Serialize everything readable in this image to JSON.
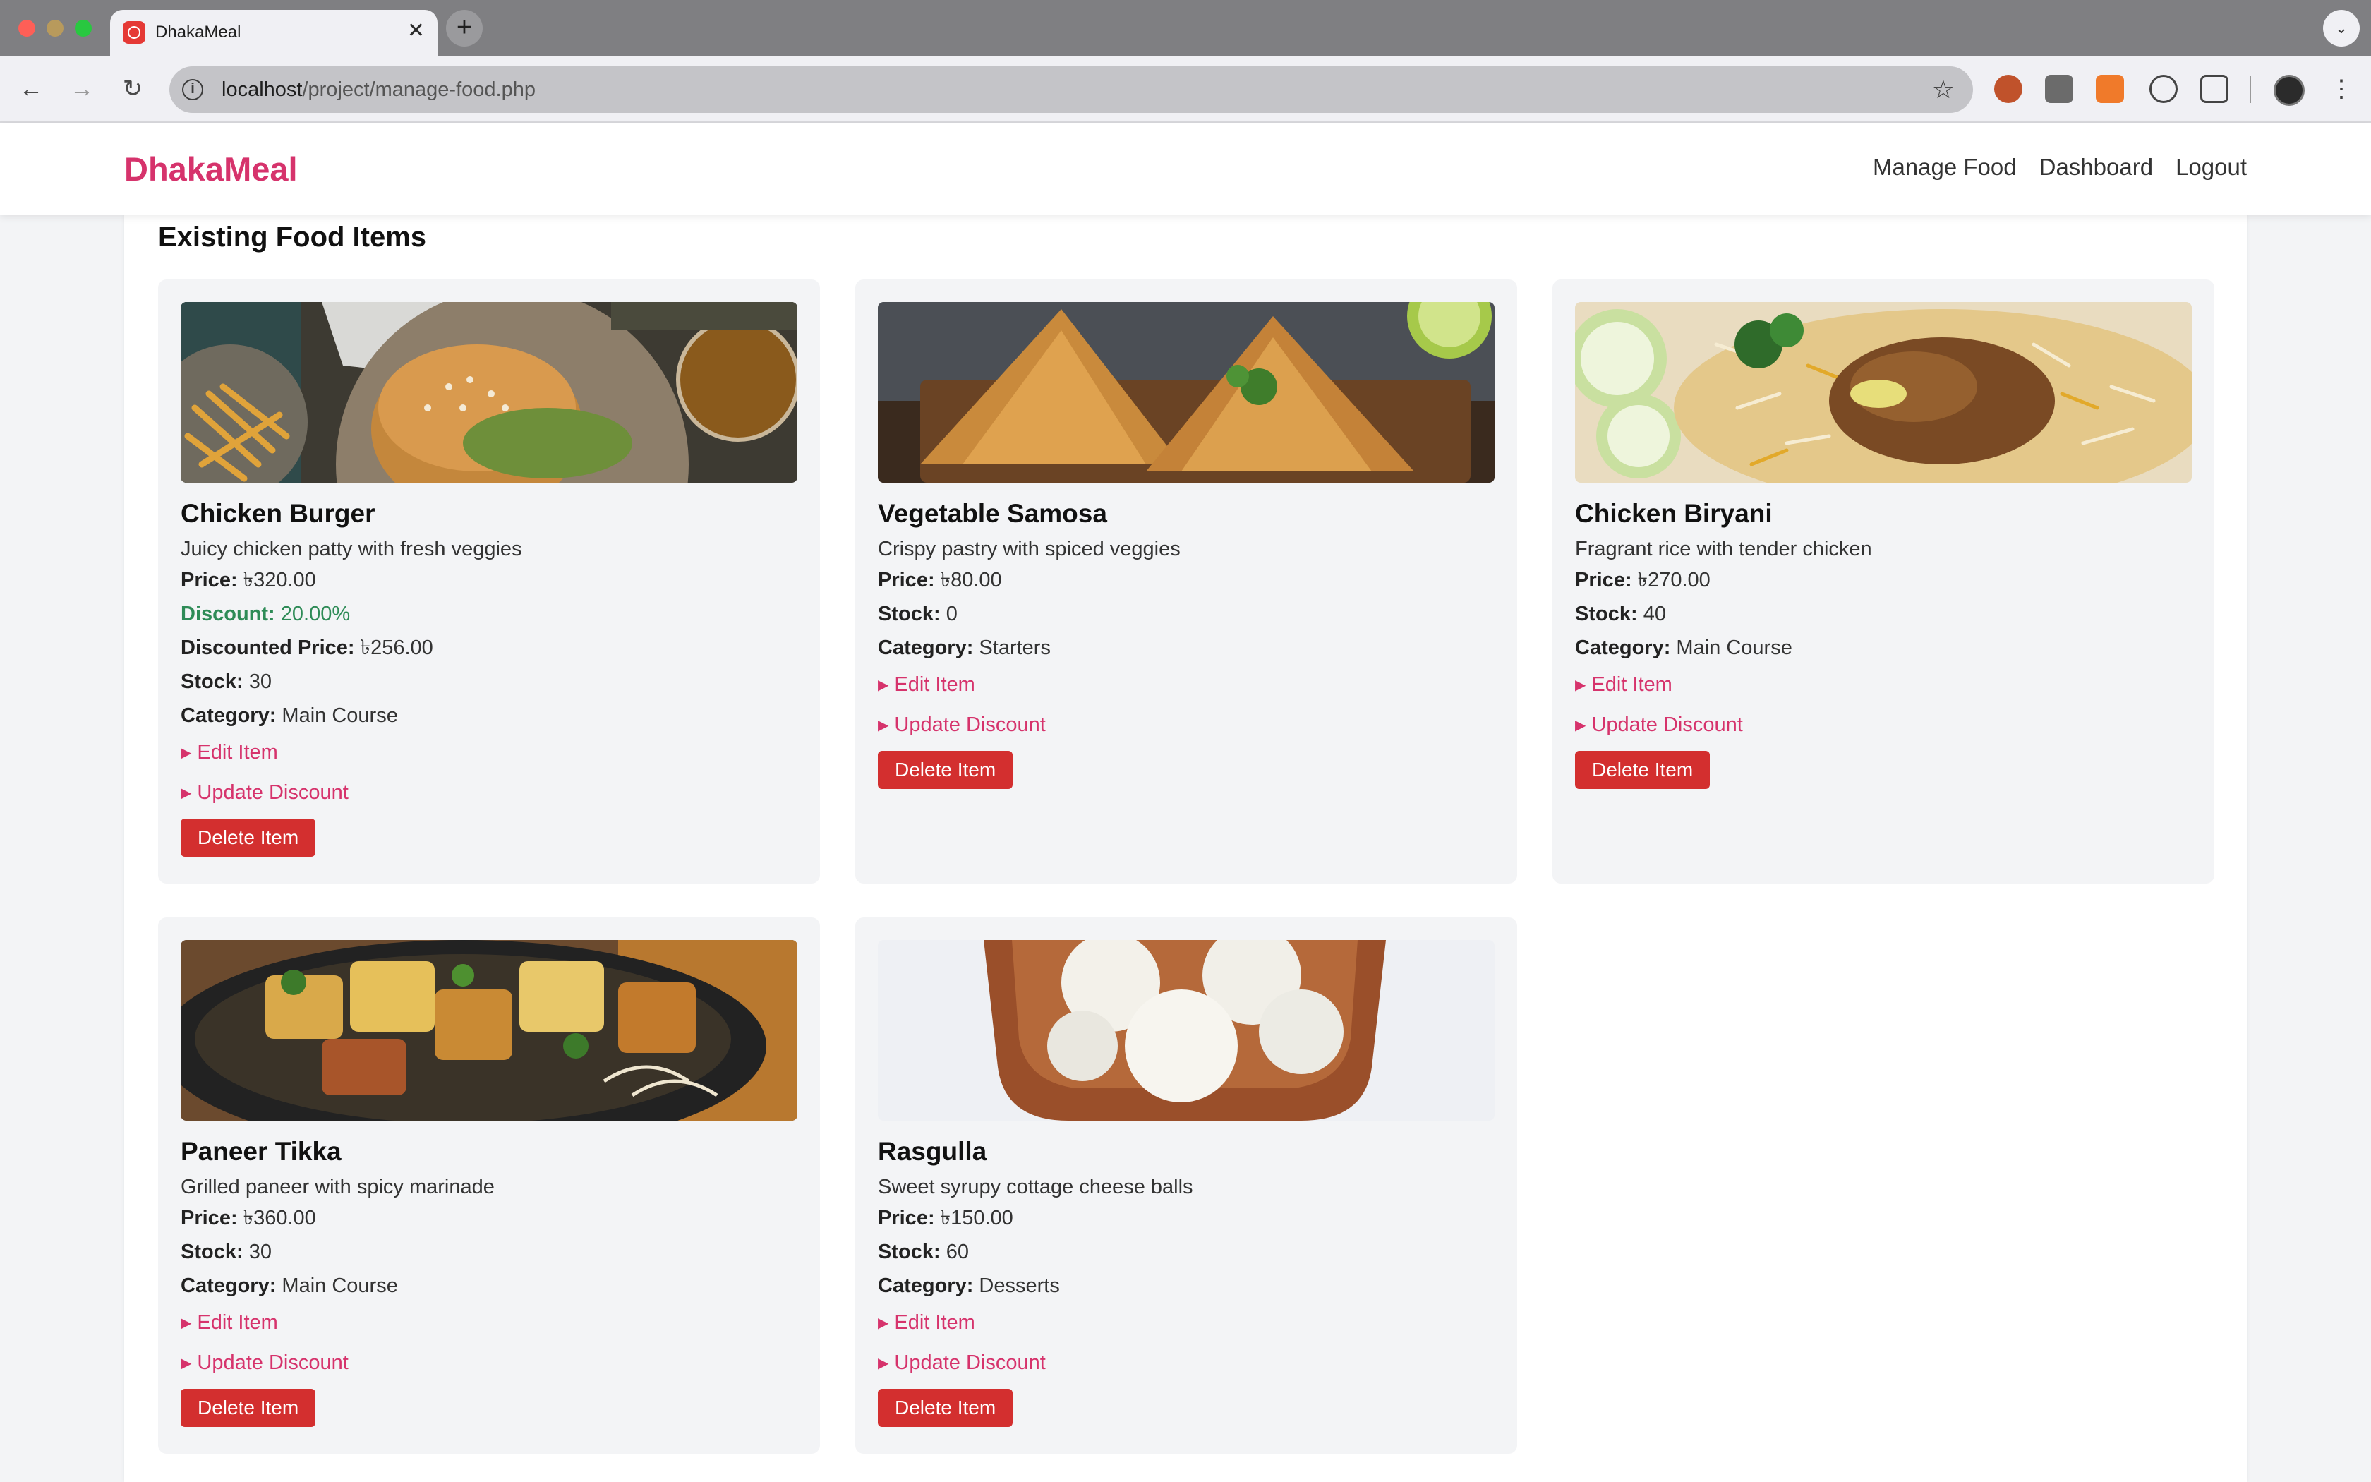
{
  "browser": {
    "tab_title": "DhakaMeal",
    "url_host": "localhost",
    "url_path": "/project/manage-food.php"
  },
  "site": {
    "brand": "DhakaMeal",
    "nav": [
      "Manage Food",
      "Dashboard",
      "Logout"
    ],
    "accent_color": "#d6336c",
    "danger_color": "#d32f2f",
    "discount_color": "#2e8b57"
  },
  "section_title": "Existing Food Items",
  "labels": {
    "price": "Price:",
    "discount": "Discount:",
    "discounted_price": "Discounted Price:",
    "stock": "Stock:",
    "category": "Category:",
    "edit": "Edit Item",
    "update_discount": "Update Discount",
    "delete": "Delete Item"
  },
  "items": [
    {
      "name": "Chicken Burger",
      "description": "Juicy chicken patty with fresh veggies",
      "price": "৳320.00",
      "discount": "20.00%",
      "discounted_price": "৳256.00",
      "stock": "30",
      "category": "Main Course",
      "image": "burger-photo"
    },
    {
      "name": "Vegetable Samosa",
      "description": "Crispy pastry with spiced veggies",
      "price": "৳80.00",
      "stock": "0",
      "category": "Starters",
      "image": "samosa-photo"
    },
    {
      "name": "Chicken Biryani",
      "description": "Fragrant rice with tender chicken",
      "price": "৳270.00",
      "stock": "40",
      "category": "Main Course",
      "image": "biryani-photo"
    },
    {
      "name": "Paneer Tikka",
      "description": "Grilled paneer with spicy marinade",
      "price": "৳360.00",
      "stock": "30",
      "category": "Main Course",
      "image": "paneer-tikka-photo"
    },
    {
      "name": "Rasgulla",
      "description": "Sweet syrupy cottage cheese balls",
      "price": "৳150.00",
      "stock": "60",
      "category": "Desserts",
      "image": "rasgulla-photo"
    }
  ]
}
